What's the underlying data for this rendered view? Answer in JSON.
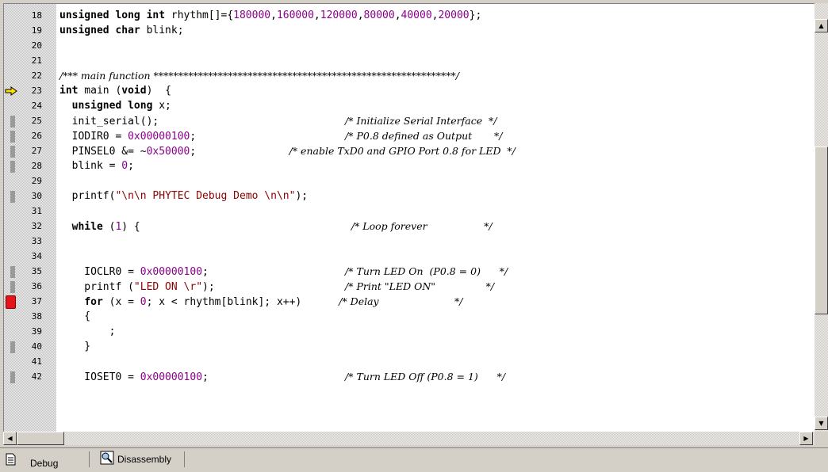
{
  "lines": [
    {
      "n": "18",
      "tokens": [
        {
          "t": "unsigned long int",
          "c": "kw"
        },
        {
          "t": " rhythm[]={",
          "c": ""
        },
        {
          "t": "180000",
          "c": "num"
        },
        {
          "t": ",",
          "c": ""
        },
        {
          "t": "160000",
          "c": "num"
        },
        {
          "t": ",",
          "c": ""
        },
        {
          "t": "120000",
          "c": "num"
        },
        {
          "t": ",",
          "c": ""
        },
        {
          "t": "80000",
          "c": "num"
        },
        {
          "t": ",",
          "c": ""
        },
        {
          "t": "40000",
          "c": "num"
        },
        {
          "t": ",",
          "c": ""
        },
        {
          "t": "20000",
          "c": "num"
        },
        {
          "t": "};",
          "c": ""
        }
      ],
      "mark": false,
      "bp": false,
      "cur": false
    },
    {
      "n": "19",
      "tokens": [
        {
          "t": "unsigned char",
          "c": "kw"
        },
        {
          "t": " blink;",
          "c": ""
        }
      ],
      "mark": false,
      "bp": false,
      "cur": false
    },
    {
      "n": "20",
      "tokens": [],
      "mark": false,
      "bp": false,
      "cur": false
    },
    {
      "n": "21",
      "tokens": [],
      "mark": false,
      "bp": false,
      "cur": false
    },
    {
      "n": "22",
      "tokens": [
        {
          "t": "/*** main function *************************************************************/",
          "c": "cm"
        }
      ],
      "mark": false,
      "bp": false,
      "cur": false
    },
    {
      "n": "23",
      "tokens": [
        {
          "t": "int",
          "c": "kw"
        },
        {
          "t": " main (",
          "c": ""
        },
        {
          "t": "void",
          "c": "kw"
        },
        {
          "t": ")  {",
          "c": ""
        }
      ],
      "mark": false,
      "bp": false,
      "cur": true
    },
    {
      "n": "24",
      "tokens": [
        {
          "t": "  ",
          "c": ""
        },
        {
          "t": "unsigned long",
          "c": "kw"
        },
        {
          "t": " x;",
          "c": ""
        }
      ],
      "mark": false,
      "bp": false,
      "cur": false
    },
    {
      "n": "25",
      "tokens": [
        {
          "t": "  init_serial();                              ",
          "c": ""
        },
        {
          "t": "/* Initialize Serial Interface  */",
          "c": "cm"
        }
      ],
      "mark": true,
      "bp": false,
      "cur": false
    },
    {
      "n": "26",
      "tokens": [
        {
          "t": "  IODIR0 = ",
          "c": ""
        },
        {
          "t": "0x00000100",
          "c": "num"
        },
        {
          "t": ";                        ",
          "c": ""
        },
        {
          "t": "/* P0.8 defined as Output       */",
          "c": "cm"
        }
      ],
      "mark": true,
      "bp": false,
      "cur": false
    },
    {
      "n": "27",
      "tokens": [
        {
          "t": "  PINSEL0 &= ~",
          "c": ""
        },
        {
          "t": "0x50000",
          "c": "num"
        },
        {
          "t": ";               ",
          "c": ""
        },
        {
          "t": "/* enable TxD0 and GPIO Port 0.8 for LED  */",
          "c": "cm"
        }
      ],
      "mark": true,
      "bp": false,
      "cur": false
    },
    {
      "n": "28",
      "tokens": [
        {
          "t": "  blink = ",
          "c": ""
        },
        {
          "t": "0",
          "c": "num"
        },
        {
          "t": ";",
          "c": ""
        }
      ],
      "mark": true,
      "bp": false,
      "cur": false
    },
    {
      "n": "29",
      "tokens": [],
      "mark": false,
      "bp": false,
      "cur": false
    },
    {
      "n": "30",
      "tokens": [
        {
          "t": "  printf(",
          "c": ""
        },
        {
          "t": "\"\\n\\n PHYTEC Debug Demo \\n\\n\"",
          "c": "str"
        },
        {
          "t": ");",
          "c": ""
        }
      ],
      "mark": true,
      "bp": false,
      "cur": false
    },
    {
      "n": "31",
      "tokens": [],
      "mark": false,
      "bp": false,
      "cur": false
    },
    {
      "n": "32",
      "tokens": [
        {
          "t": "  ",
          "c": ""
        },
        {
          "t": "while",
          "c": "kw"
        },
        {
          "t": " (",
          "c": ""
        },
        {
          "t": "1",
          "c": "num"
        },
        {
          "t": ") {                                  ",
          "c": ""
        },
        {
          "t": "/* Loop forever                  */",
          "c": "cm"
        }
      ],
      "mark": false,
      "bp": false,
      "cur": false
    },
    {
      "n": "33",
      "tokens": [],
      "mark": false,
      "bp": false,
      "cur": false
    },
    {
      "n": "34",
      "tokens": [],
      "mark": false,
      "bp": false,
      "cur": false
    },
    {
      "n": "35",
      "tokens": [
        {
          "t": "    IOCLR0 = ",
          "c": ""
        },
        {
          "t": "0x00000100",
          "c": "num"
        },
        {
          "t": ";                      ",
          "c": ""
        },
        {
          "t": "/* Turn LED On  (P0.8 = 0)      */",
          "c": "cm"
        }
      ],
      "mark": true,
      "bp": false,
      "cur": false
    },
    {
      "n": "36",
      "tokens": [
        {
          "t": "    printf (",
          "c": ""
        },
        {
          "t": "\"LED ON \\r\"",
          "c": "str"
        },
        {
          "t": ");                     ",
          "c": ""
        },
        {
          "t": "/* Print \"LED ON\"                */",
          "c": "cm"
        }
      ],
      "mark": true,
      "bp": false,
      "cur": false
    },
    {
      "n": "37",
      "tokens": [
        {
          "t": "    ",
          "c": ""
        },
        {
          "t": "for",
          "c": "kw"
        },
        {
          "t": " (x = ",
          "c": ""
        },
        {
          "t": "0",
          "c": "num"
        },
        {
          "t": "; x < rhythm[blink]; x++)      ",
          "c": ""
        },
        {
          "t": "/* Delay                        */",
          "c": "cm"
        }
      ],
      "mark": false,
      "bp": true,
      "cur": false
    },
    {
      "n": "38",
      "tokens": [
        {
          "t": "    {",
          "c": ""
        }
      ],
      "mark": false,
      "bp": false,
      "cur": false
    },
    {
      "n": "39",
      "tokens": [
        {
          "t": "        ;",
          "c": ""
        }
      ],
      "mark": false,
      "bp": false,
      "cur": false
    },
    {
      "n": "40",
      "tokens": [
        {
          "t": "    }",
          "c": ""
        }
      ],
      "mark": true,
      "bp": false,
      "cur": false
    },
    {
      "n": "41",
      "tokens": [],
      "mark": false,
      "bp": false,
      "cur": false
    },
    {
      "n": "42",
      "tokens": [
        {
          "t": "    IOSET0 = ",
          "c": ""
        },
        {
          "t": "0x00000100",
          "c": "num"
        },
        {
          "t": ";                      ",
          "c": ""
        },
        {
          "t": "/* Turn LED Off (P0.8 = 1)      */",
          "c": "cm"
        }
      ],
      "mark": true,
      "bp": false,
      "cur": false
    }
  ],
  "tabs": [
    {
      "label": "Debug",
      "icon": "document-icon",
      "active": true
    },
    {
      "label": "Disassembly",
      "icon": "magnifier-icon",
      "active": false
    }
  ],
  "icons": {
    "current_line": "current-line-arrow-icon",
    "breakpoint": "breakpoint-icon",
    "scroll_up": "scroll-up-arrow-icon",
    "scroll_down": "scroll-down-arrow-icon",
    "scroll_left": "scroll-left-arrow-icon",
    "scroll_right": "scroll-right-arrow-icon"
  },
  "colors": {
    "keyword": "#000000",
    "number": "#8b008b",
    "string": "#8b0000",
    "breakpoint": "#e4141c",
    "arrow": "#ffe000"
  }
}
